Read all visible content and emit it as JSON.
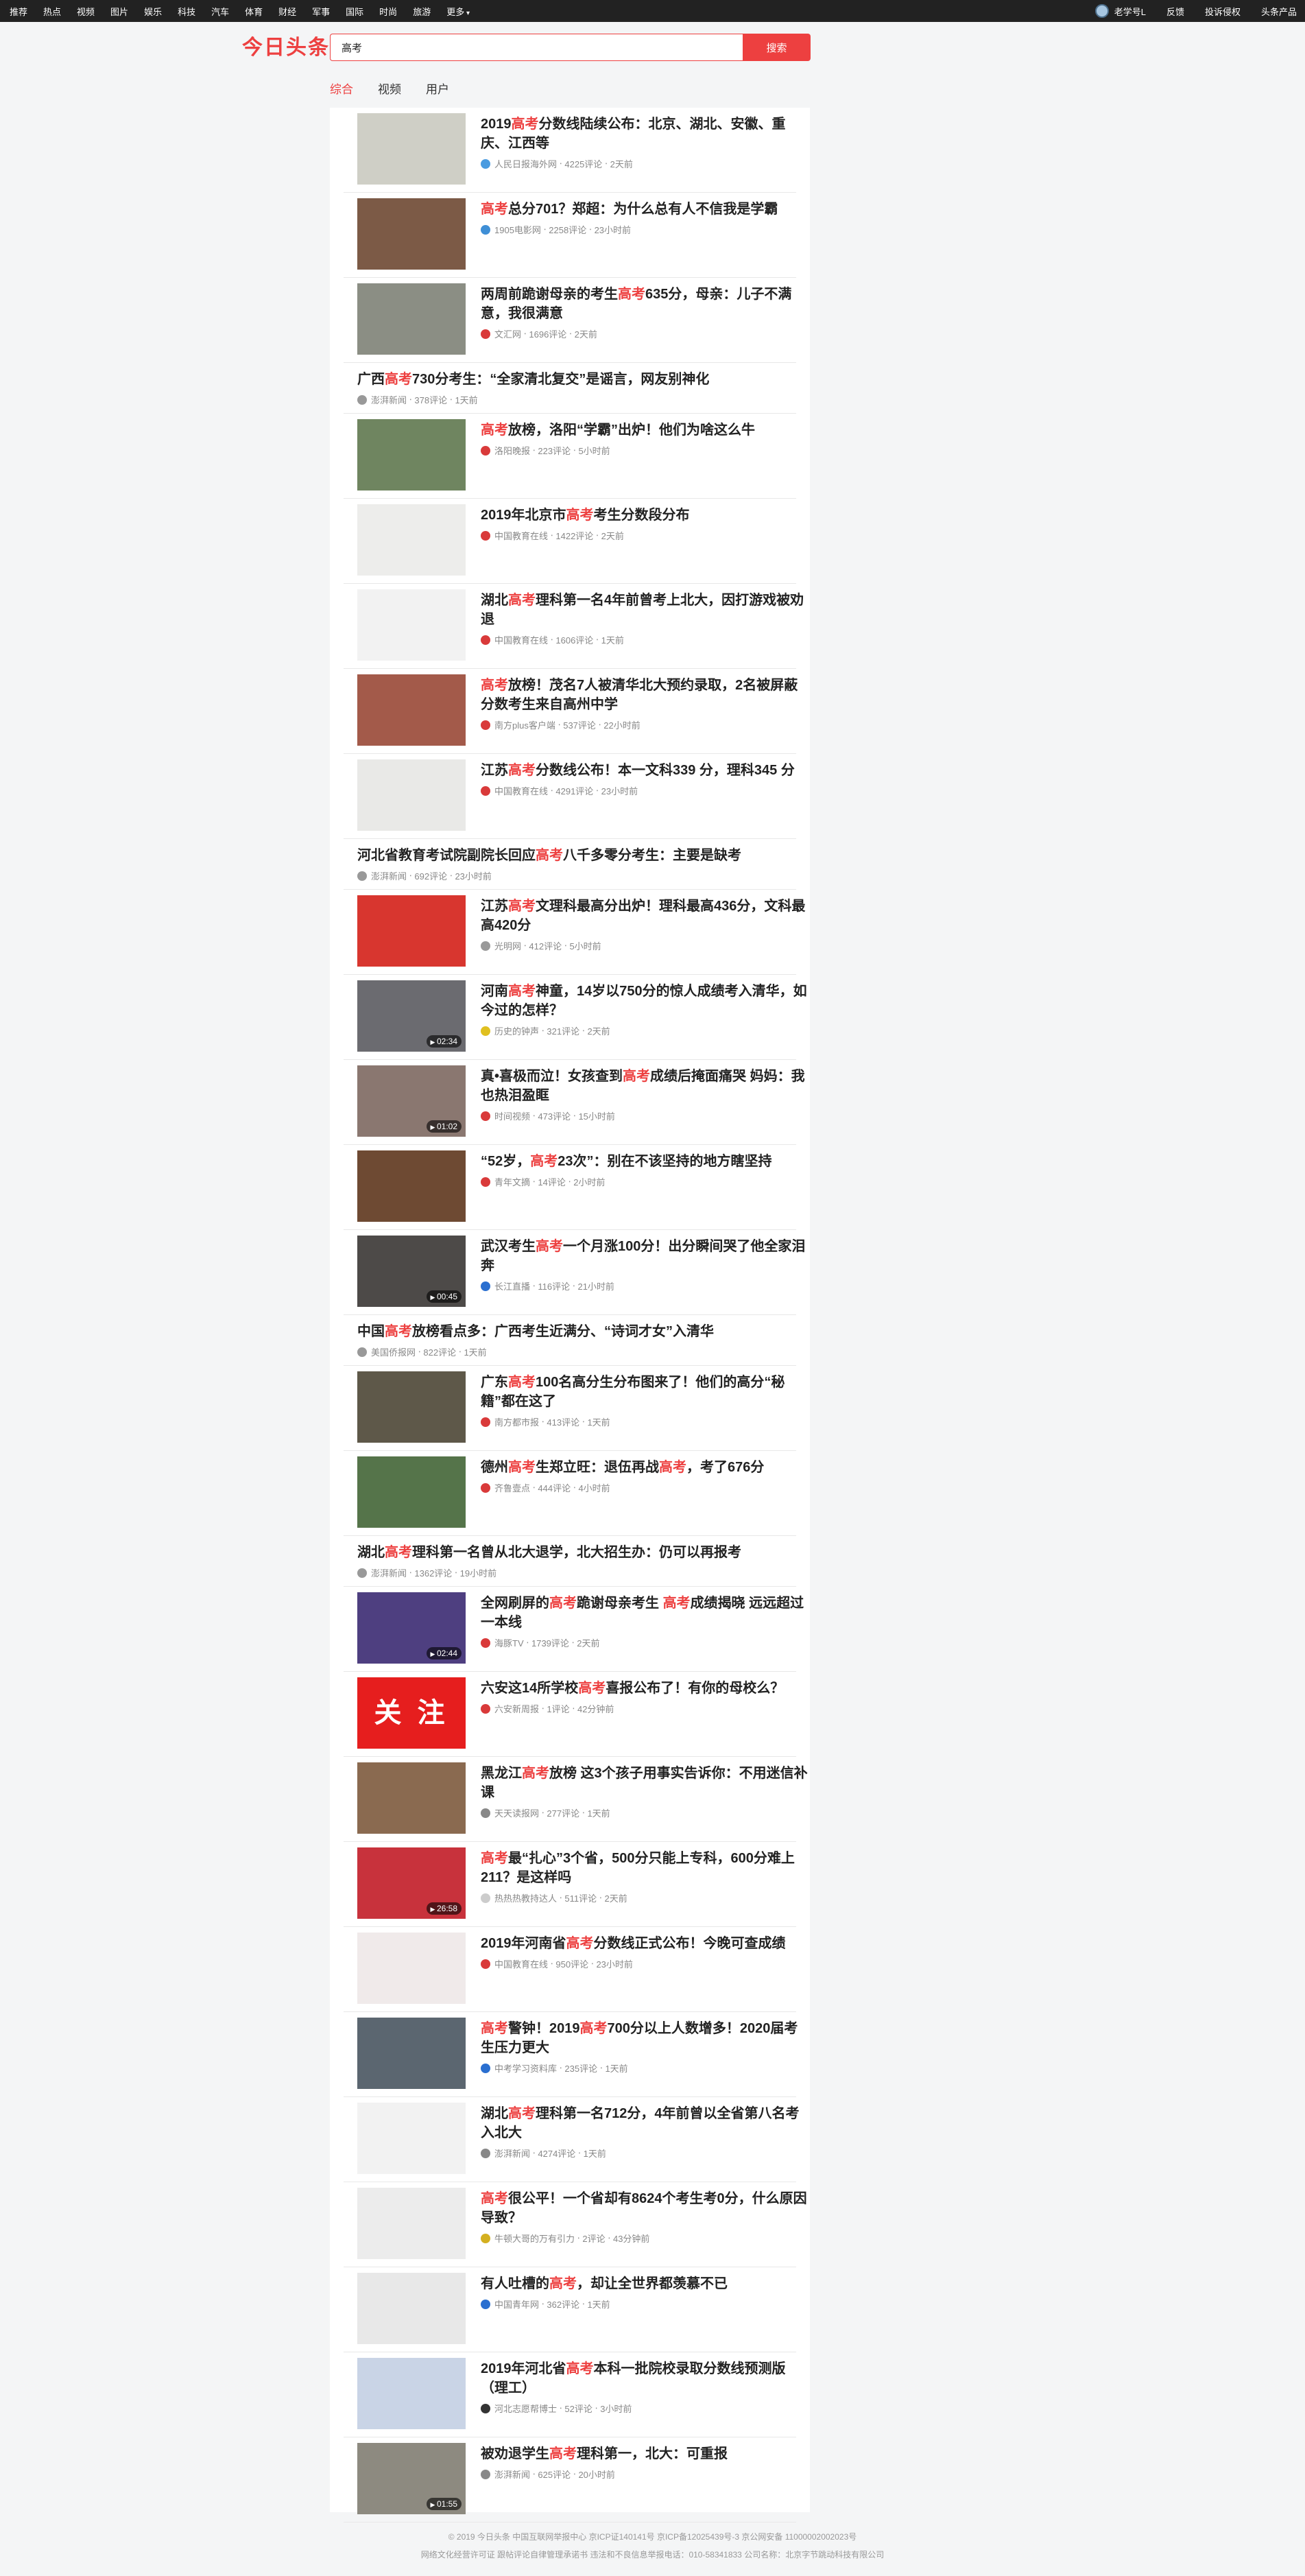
{
  "topnav": {
    "items": [
      "推荐",
      "热点",
      "视频",
      "图片",
      "娱乐",
      "科技",
      "汽车",
      "体育",
      "财经",
      "军事",
      "国际",
      "时尚",
      "旅游"
    ],
    "more": "更多"
  },
  "topright": {
    "user": "老学号L",
    "feedback": "反馈",
    "complaint": "投诉侵权",
    "products": "头条产品"
  },
  "header": {
    "logo": "今日头条",
    "search_value": "高考",
    "search_button": "搜索"
  },
  "tabs": [
    "综合",
    "视频",
    "用户"
  ],
  "results": [
    {
      "title": "2019高考分数线陆续公布：北京、湖北、安徽、重庆、江西等",
      "source": "人民日报海外网",
      "comments": "4225评论",
      "time": "2天前",
      "thumb": "#cfcfc6",
      "icon": "#4a9be0"
    },
    {
      "title": "高考总分701？郑超：为什么总有人不信我是学霸",
      "source": "1905电影网",
      "comments": "2258评论",
      "time": "23小时前",
      "thumb": "#7c5a46",
      "icon": "#3f8fd6"
    },
    {
      "title": "两周前跪谢母亲的考生高考635分，母亲：儿子不满意，我很满意",
      "source": "文汇网",
      "comments": "1696评论",
      "time": "2天前",
      "thumb": "#8b8e84",
      "icon": "#d93a3a"
    },
    {
      "title": "广西高考730分考生：“全家清北复交”是谣言，网友别神化",
      "source": "澎湃新闻",
      "comments": "378评论",
      "time": "1天前"
    },
    {
      "title": "高考放榜，洛阳“学霸”出炉！他们为啥这么牛",
      "source": "洛阳晚报",
      "comments": "223评论",
      "time": "5小时前",
      "thumb": "#6f8560",
      "icon": "#d93a3a"
    },
    {
      "title": "2019年北京市高考考生分数段分布",
      "source": "中国教育在线",
      "comments": "1422评论",
      "time": "2天前",
      "thumb": "#ededeb",
      "icon": "#d93a3a"
    },
    {
      "title": "湖北高考理科第一名4年前曾考上北大，因打游戏被劝退",
      "source": "中国教育在线",
      "comments": "1606评论",
      "time": "1天前",
      "thumb": "#f2f2f2",
      "icon": "#d93a3a"
    },
    {
      "title": "高考放榜！茂名7人被清华北大预约录取，2名被屏蔽分数考生来自高州中学",
      "source": "南方plus客户端",
      "comments": "537评论",
      "time": "22小时前",
      "thumb": "#a35a4a",
      "icon": "#d93a3a"
    },
    {
      "title": "江苏高考分数线公布！本一文科339 分，理科345 分",
      "source": "中国教育在线",
      "comments": "4291评论",
      "time": "23小时前",
      "thumb": "#e9e9e7",
      "icon": "#d93a3a"
    },
    {
      "title": "河北省教育考试院副院长回应高考八千多零分考生：主要是缺考",
      "source": "澎湃新闻",
      "comments": "692评论",
      "time": "23小时前"
    },
    {
      "title": "江苏高考文理科最高分出炉！理科最高436分，文科最高420分",
      "source": "光明网",
      "comments": "412评论",
      "time": "5小时前",
      "thumb": "#d8362f",
      "icon": "#999999"
    },
    {
      "title": "河南高考神童，14岁以750分的惊人成绩考入清华，如今过的怎样？",
      "source": "历史的钟声",
      "comments": "321评论",
      "time": "2天前",
      "thumb": "#6b6b70",
      "icon": "#e0c020",
      "duration": "02:34"
    },
    {
      "title": "真•喜极而泣！女孩查到高考成绩后掩面痛哭 妈妈：我也热泪盈眶",
      "source": "时间视频",
      "comments": "473评论",
      "time": "15小时前",
      "thumb": "#8a7770",
      "icon": "#d93a3a",
      "duration": "01:02"
    },
    {
      "title": "“52岁，高考23次”：别在不该坚持的地方瞎坚持",
      "source": "青年文摘",
      "comments": "14评论",
      "time": "2小时前",
      "thumb": "#6e4a33",
      "icon": "#d93a3a"
    },
    {
      "title": "武汉考生高考一个月涨100分！出分瞬间哭了他全家泪奔",
      "source": "长江直播",
      "comments": "116评论",
      "time": "21小时前",
      "thumb": "#4d4a48",
      "icon": "#2a6fd0",
      "duration": "00:45"
    },
    {
      "title": "中国高考放榜看点多：广西考生近满分、“诗词才女”入清华",
      "source": "美国侨报网",
      "comments": "822评论",
      "time": "1天前"
    },
    {
      "title": "广东高考100名高分生分布图来了！他们的高分“秘籍”都在这了",
      "source": "南方都市报",
      "comments": "413评论",
      "time": "1天前",
      "thumb": "#5e5849",
      "icon": "#d93a3a"
    },
    {
      "title": "德州高考生郑立旺：退伍再战高考，考了676分",
      "source": "齐鲁壹点",
      "comments": "444评论",
      "time": "4小时前",
      "thumb": "#55744a",
      "icon": "#d93a3a"
    },
    {
      "title": "湖北高考理科第一名曾从北大退学，北大招生办：仍可以再报考",
      "source": "澎湃新闻",
      "comments": "1362评论",
      "time": "19小时前"
    },
    {
      "title": "全网刷屏的高考跪谢母亲考生 高考成绩揭晓 远远超过一本线",
      "source": "海豚TV",
      "comments": "1739评论",
      "time": "2天前",
      "thumb": "#4e3f80",
      "icon": "#d93a3a",
      "duration": "02:44"
    },
    {
      "title": "六安这14所学校高考喜报公布了！有你的母校么？",
      "source": "六安新周报",
      "comments": "1评论",
      "time": "42分钟前",
      "thumb": "#e61e1e",
      "icon": "#d93a3a",
      "thumb_text": "关 注"
    },
    {
      "title": "黑龙江高考放榜 这3个孩子用事实告诉你：不用迷信补课",
      "source": "天天读报网",
      "comments": "277评论",
      "time": "1天前",
      "thumb": "#8a6a50",
      "icon": "#888888"
    },
    {
      "title": "高考最“扎心”3个省，500分只能上专科，600分难上211？是这样吗",
      "source": "热热热教持达人",
      "comments": "511评论",
      "time": "2天前",
      "thumb": "#c8323c",
      "icon": "#cccccc",
      "duration": "26:58"
    },
    {
      "title": "2019年河南省高考分数线正式公布！今晚可查成绩",
      "source": "中国教育在线",
      "comments": "950评论",
      "time": "23小时前",
      "thumb": "#f0eaea",
      "icon": "#d93a3a"
    },
    {
      "title": "高考警钟！2019高考700分以上人数增多！2020届考生压力更大",
      "source": "中考学习资料库",
      "comments": "235评论",
      "time": "1天前",
      "thumb": "#5b6670",
      "icon": "#2a6fd0"
    },
    {
      "title": "湖北高考理科第一名712分，4年前曾以全省第八名考入北大",
      "source": "澎湃新闻",
      "comments": "4274评论",
      "time": "1天前",
      "thumb": "#f2f2f2",
      "icon": "#888888"
    },
    {
      "title": "高考很公平！一个省却有8624个考生考0分，什么原因导致？",
      "source": "牛顿大哥的万有引力",
      "comments": "2评论",
      "time": "43分钟前",
      "thumb": "#ececec",
      "icon": "#d4b020"
    },
    {
      "title": "有人吐槽的高考，却让全世界都羡慕不已",
      "source": "中国青年网",
      "comments": "362评论",
      "time": "1天前",
      "thumb": "#e8e8e8",
      "icon": "#2a6fd0"
    },
    {
      "title": "2019年河北省高考本科一批院校录取分数线预测版（理工）",
      "source": "河北志愿帮博士",
      "comments": "52评论",
      "time": "3小时前",
      "thumb": "#c9d4e6",
      "icon": "#333333"
    },
    {
      "title": "被劝退学生高考理科第一，北大：可重报",
      "source": "澎湃新闻",
      "comments": "625评论",
      "time": "20小时前",
      "thumb": "#8d8a80",
      "icon": "#888888",
      "duration": "01:55"
    }
  ],
  "footer": {
    "line1": "© 2019 今日头条  中国互联网举报中心  京ICP证140141号  京ICP备12025439号-3  京公网安备 11000002002023号",
    "line2": "网络文化经营许可证  跟帖评论自律管理承诺书  违法和不良信息举报电话：010-58341833  公司名称：北京字节跳动科技有限公司"
  }
}
